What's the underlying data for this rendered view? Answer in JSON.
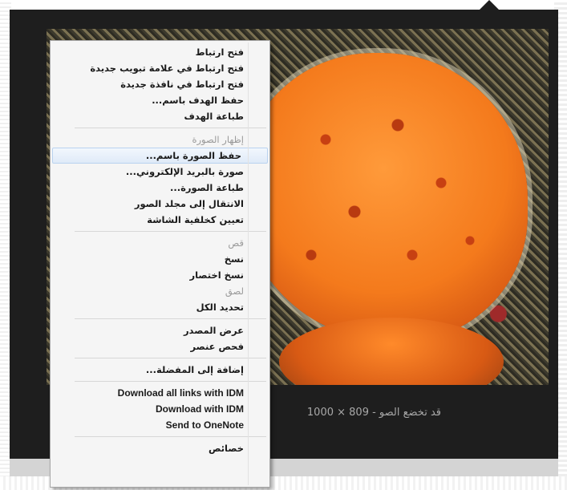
{
  "caption": "1000 × 809 - قد تخضع الصو",
  "context_menu": {
    "items": [
      {
        "label": "فتح ارتباط"
      },
      {
        "label": "فتح ارتباط في علامة تبويب جديدة"
      },
      {
        "label": "فتح ارتباط في نافذة جديدة"
      },
      {
        "label": "حفظ الهدف باسم..."
      },
      {
        "label": "طباعة الهدف"
      },
      {
        "label": "إظهار الصورة",
        "disabled": true
      },
      {
        "label": "حفظ الصورة باسم...",
        "highlighted": true
      },
      {
        "label": "صورة بالبريد الإلكتروني..."
      },
      {
        "label": "طباعة الصورة..."
      },
      {
        "label": "الانتقال إلى مجلد الصور"
      },
      {
        "label": "تعيين كخلفية الشاشة"
      },
      {
        "label": "قص",
        "disabled": true
      },
      {
        "label": "نسخ"
      },
      {
        "label": "نسخ اختصار"
      },
      {
        "label": "لصق",
        "disabled": true
      },
      {
        "label": "تحديد الكل"
      },
      {
        "label": "عرض المصدر"
      },
      {
        "label": "فحص عنصر"
      },
      {
        "label": "إضافة إلى المفضلة..."
      },
      {
        "label": "Download all links with IDM"
      },
      {
        "label": "Download with IDM"
      },
      {
        "label": "Send to OneNote"
      },
      {
        "label": "خصائص"
      }
    ]
  },
  "colors": {
    "panel_bg": "#1e1e1e",
    "menu_bg": "#f5f5f5",
    "highlight": "#dfeaf8",
    "sponge_orange": "#f47a1c"
  }
}
